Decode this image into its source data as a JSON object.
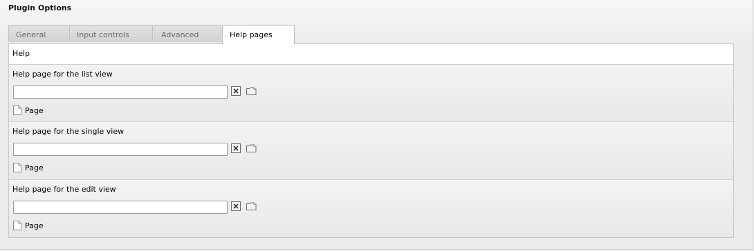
{
  "title": "Plugin Options",
  "tabs": [
    {
      "label": "General",
      "active": false
    },
    {
      "label": "Input controls",
      "active": false
    },
    {
      "label": "Advanced",
      "active": false
    },
    {
      "label": "Help pages",
      "active": true
    }
  ],
  "section": {
    "heading": "Help"
  },
  "fields": [
    {
      "label": "Help page for the list view",
      "value": "",
      "type_label": "Page"
    },
    {
      "label": "Help page for the single view",
      "value": "",
      "type_label": "Page"
    },
    {
      "label": "Help page for the edit view",
      "value": "",
      "type_label": "Page"
    }
  ],
  "icons": {
    "clear": "close-icon",
    "browse": "folder-icon",
    "record_type": "page-icon"
  },
  "colors": {
    "active_tab": "#ffffff",
    "inactive_tab": "#d8d8d8",
    "panel_background": "#ebebeb"
  }
}
